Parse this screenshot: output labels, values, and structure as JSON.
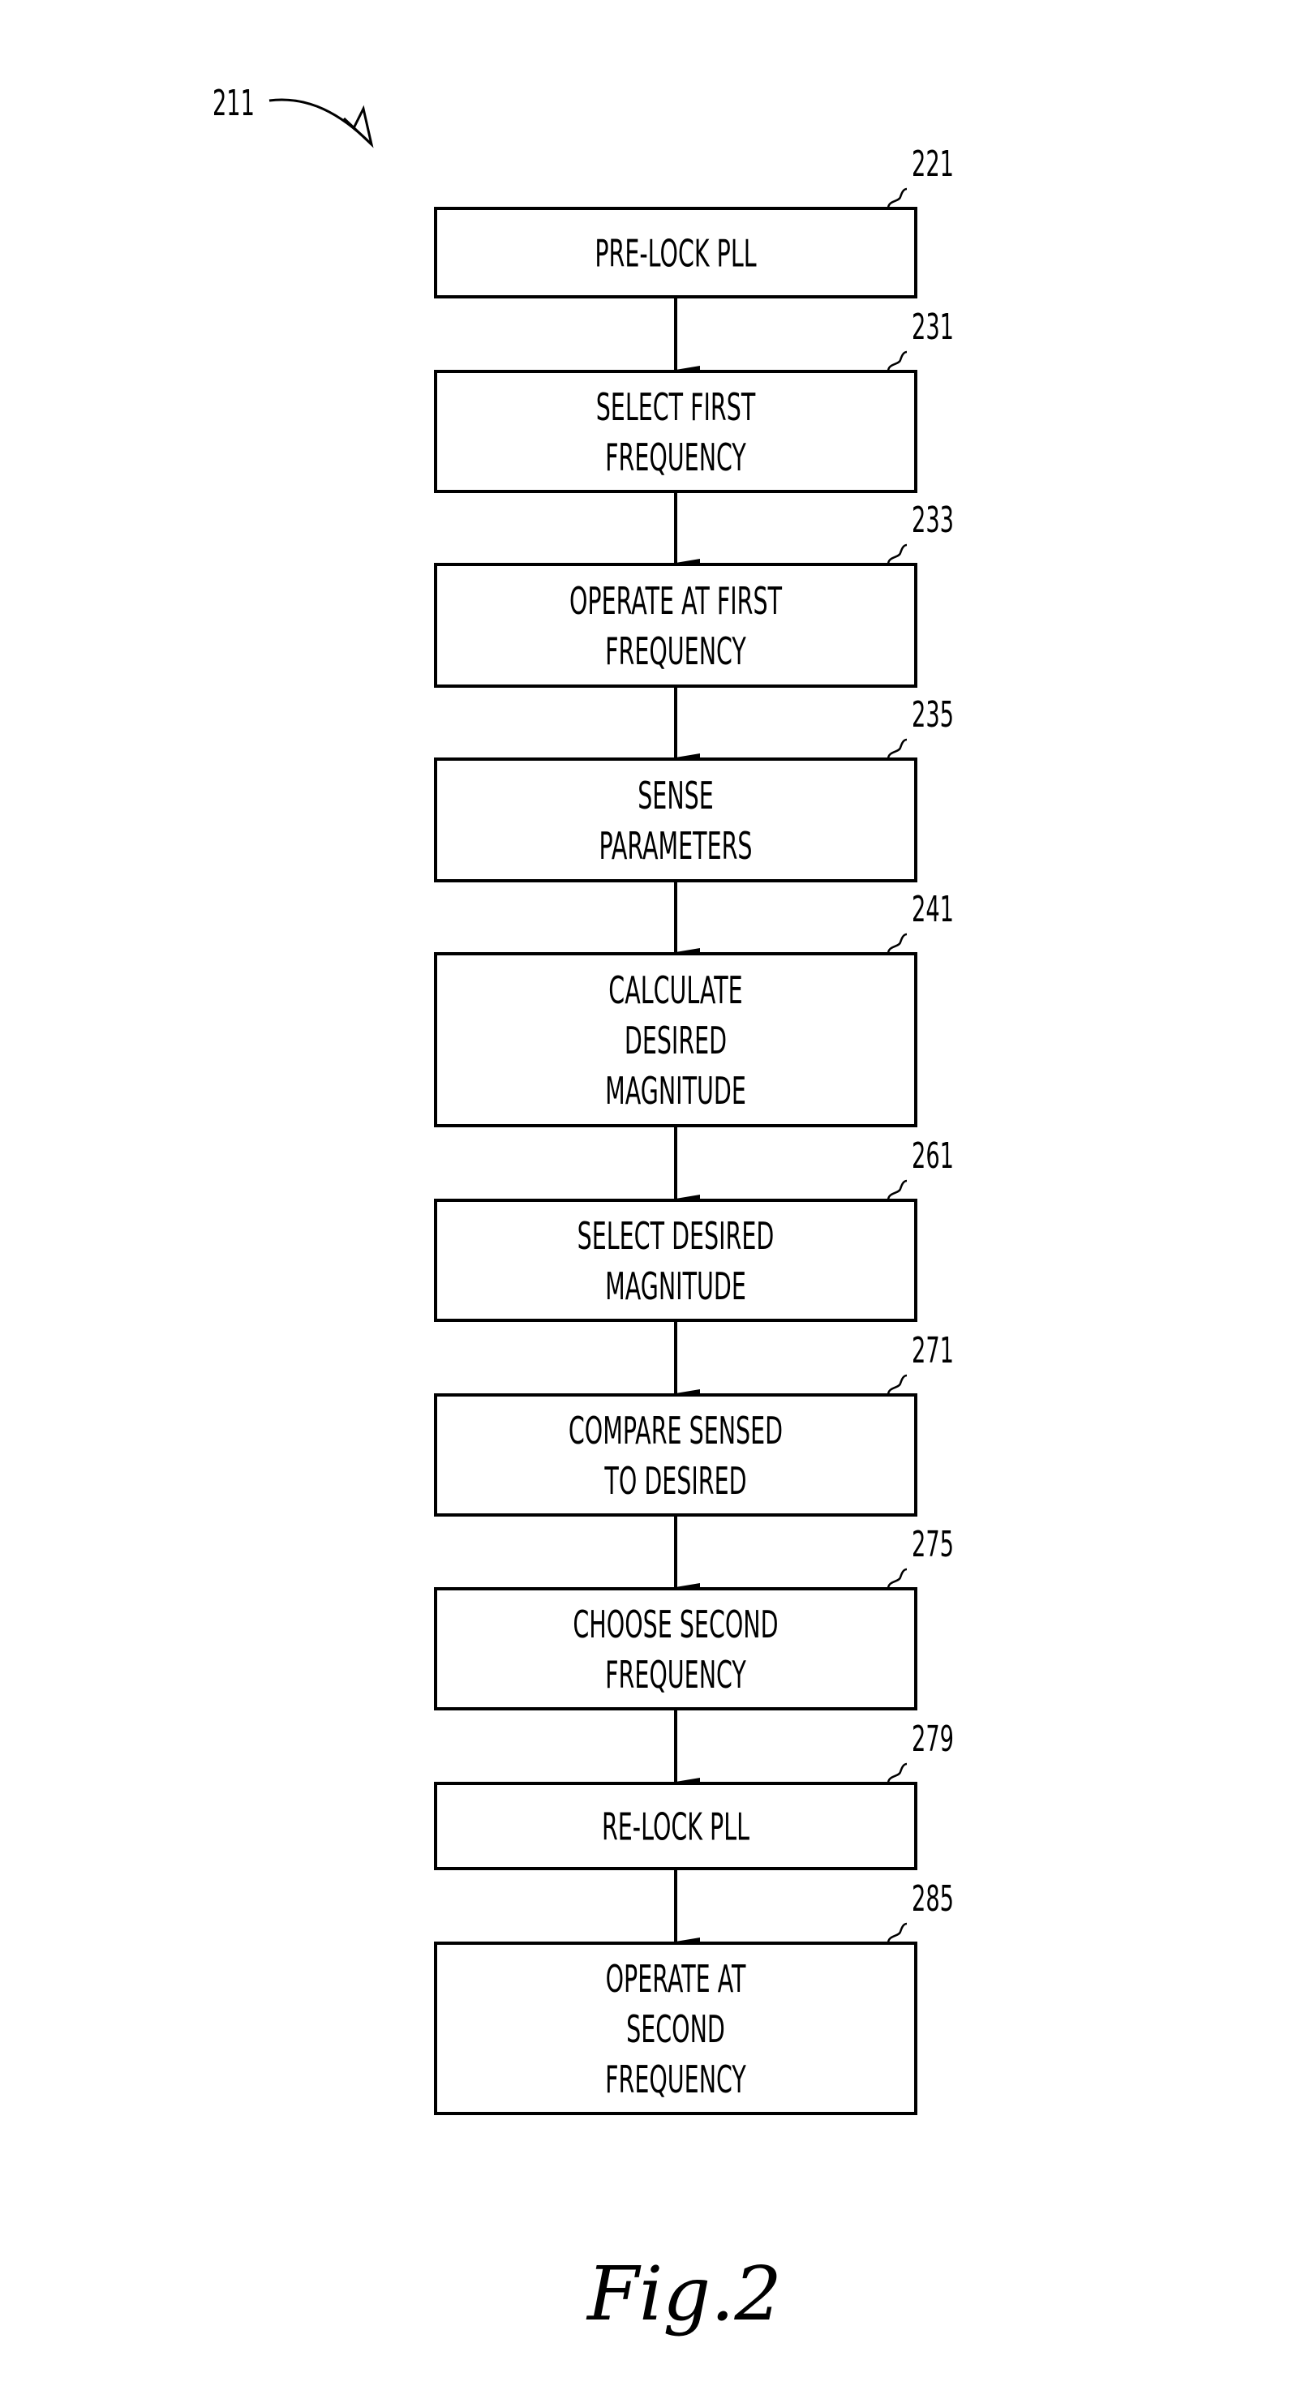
{
  "figure": {
    "reference": "211",
    "caption": "Fig.2"
  },
  "steps": [
    {
      "ref": "221",
      "lines": [
        "PRE-LOCK PLL"
      ]
    },
    {
      "ref": "231",
      "lines": [
        "SELECT FIRST",
        "FREQUENCY"
      ]
    },
    {
      "ref": "233",
      "lines": [
        "OPERATE AT FIRST",
        "FREQUENCY"
      ]
    },
    {
      "ref": "235",
      "lines": [
        "SENSE",
        "PARAMETERS"
      ]
    },
    {
      "ref": "241",
      "lines": [
        "CALCULATE",
        "DESIRED",
        "MAGNITUDE"
      ]
    },
    {
      "ref": "261",
      "lines": [
        "SELECT DESIRED",
        "MAGNITUDE"
      ]
    },
    {
      "ref": "271",
      "lines": [
        "COMPARE SENSED",
        "TO DESIRED"
      ]
    },
    {
      "ref": "275",
      "lines": [
        "CHOOSE SECOND",
        "FREQUENCY"
      ]
    },
    {
      "ref": "279",
      "lines": [
        "RE-LOCK PLL"
      ]
    },
    {
      "ref": "285",
      "lines": [
        "OPERATE AT",
        "SECOND",
        "FREQUENCY"
      ]
    }
  ]
}
